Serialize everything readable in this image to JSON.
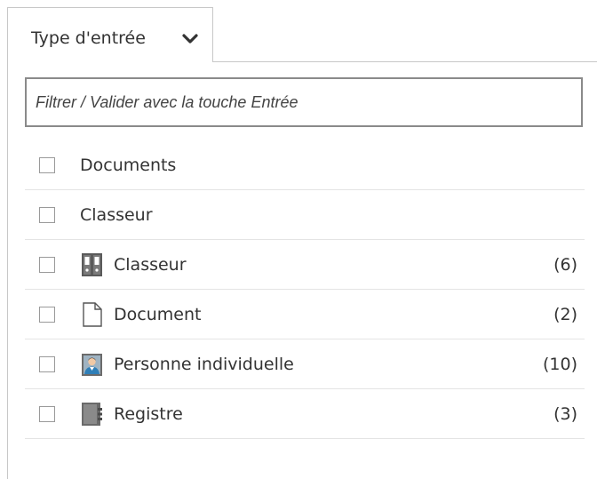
{
  "tab": {
    "label": "Type d'entrée",
    "icon": "chevron-down-icon"
  },
  "filter": {
    "placeholder": "Filtrer / Valider avec la touche Entrée",
    "value": ""
  },
  "list": {
    "items": [
      {
        "label": "Documents",
        "icon": null,
        "count": "",
        "checked": false
      },
      {
        "label": "Classeur",
        "icon": null,
        "count": "",
        "checked": false
      },
      {
        "label": "Classeur",
        "icon": "binder-icon",
        "count": "(6)",
        "checked": false
      },
      {
        "label": "Document",
        "icon": "document-icon",
        "count": "(2)",
        "checked": false
      },
      {
        "label": "Personne individuelle",
        "icon": "person-icon",
        "count": "(10)",
        "checked": false
      },
      {
        "label": "Registre",
        "icon": "register-icon",
        "count": "(3)",
        "checked": false
      }
    ]
  },
  "colors": {
    "border": "#c8c8c8",
    "input_border": "#8a8a8a",
    "text": "#333333",
    "divider": "#e4e4e4"
  }
}
